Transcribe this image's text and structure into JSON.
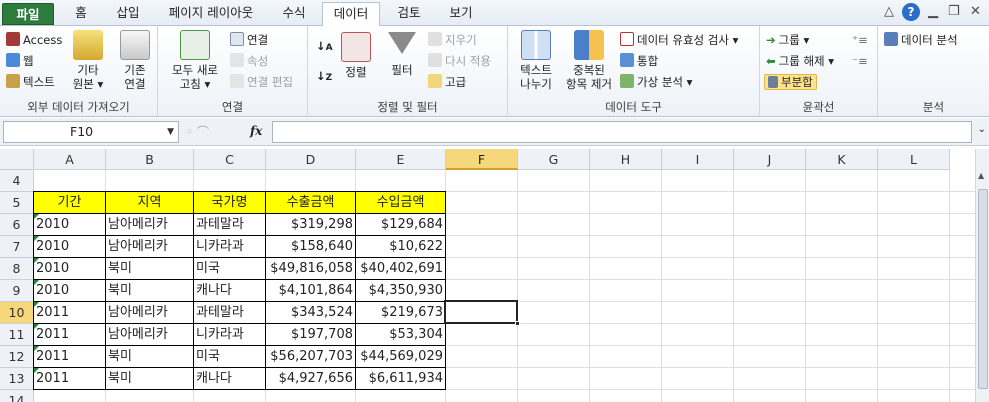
{
  "tabs": [
    "파일",
    "홈",
    "삽입",
    "페이지 레이아웃",
    "수식",
    "데이터",
    "검토",
    "보기"
  ],
  "active_tab": "데이터",
  "ribbon": {
    "external": {
      "label": "외부 데이터 가져오기",
      "access": "Access",
      "web": "웹",
      "text": "텍스트",
      "other_line1": "기타",
      "other_line2": "원본 ▾",
      "existing_line1": "기존",
      "existing_line2": "연결"
    },
    "connections": {
      "label": "연결",
      "refresh_line1": "모두 새로",
      "refresh_line2": "고침 ▾",
      "connections": "연결",
      "properties": "속성",
      "edit_links": "연결 편집"
    },
    "sort_filter": {
      "label": "정렬 및 필터",
      "sort": "정렬",
      "filter": "필터",
      "clear": "지우기",
      "reapply": "다시 적용",
      "advanced": "고급"
    },
    "data_tools": {
      "label": "데이터 도구",
      "text_to_cols_line1": "텍스트",
      "text_to_cols_line2": "나누기",
      "remove_dup_line1": "중복된",
      "remove_dup_line2": "항목 제거",
      "validation": "데이터 유효성 검사 ▾",
      "consolidate": "통합",
      "whatif": "가상 분석 ▾"
    },
    "outline": {
      "label": "윤곽선",
      "group": "그룹 ▾",
      "ungroup": "그룹 해제 ▾",
      "subtotal": "부분합"
    },
    "analysis": {
      "label": "분석",
      "data_analysis": "데이터 분석"
    }
  },
  "namebox": "F10",
  "fx": "fx",
  "columns": [
    "A",
    "B",
    "C",
    "D",
    "E",
    "F",
    "G",
    "H",
    "I",
    "J",
    "K",
    "L"
  ],
  "rows": [
    "4",
    "5",
    "6",
    "7",
    "8",
    "9",
    "10",
    "11",
    "12",
    "13",
    "14"
  ],
  "table": {
    "headers": [
      "기간",
      "지역",
      "국가명",
      "수출금액",
      "수입금액"
    ],
    "data": [
      [
        "2010",
        "남아메리카",
        "과테말라",
        "$319,298",
        "$129,684"
      ],
      [
        "2010",
        "남아메리카",
        "니카라과",
        "$158,640",
        "$10,622"
      ],
      [
        "2010",
        "북미",
        "미국",
        "$49,816,058",
        "$40,402,691"
      ],
      [
        "2010",
        "북미",
        "캐나다",
        "$4,101,864",
        "$4,350,930"
      ],
      [
        "2011",
        "남아메리카",
        "과테말라",
        "$343,524",
        "$219,673"
      ],
      [
        "2011",
        "남아메리카",
        "니카라과",
        "$197,708",
        "$53,304"
      ],
      [
        "2011",
        "북미",
        "미국",
        "$56,207,703",
        "$44,569,029"
      ],
      [
        "2011",
        "북미",
        "캐나다",
        "$4,927,656",
        "$6,611,934"
      ]
    ]
  },
  "selected_cell": "F10",
  "colors": {
    "file_tab": "#2e7b3e",
    "header_fill": "#ffff00",
    "selection_header": "#f7d77b"
  }
}
